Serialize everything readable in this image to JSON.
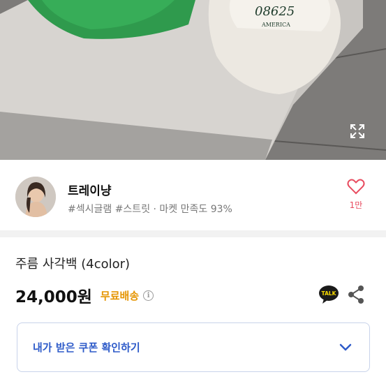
{
  "hero": {
    "cap_text_top": "08625",
    "cap_text_bottom": "AMERICA"
  },
  "seller": {
    "name": "트레이냥",
    "tags": "#섹시글램 #스트릿 · 마켓 만족도 93%",
    "like_count": "1만"
  },
  "product": {
    "name": "주름 사각백 (4color)",
    "price": "24,000원",
    "shipping": "무료배송",
    "info_glyph": "i",
    "talk_badge": "TALK"
  },
  "coupon": {
    "label": "내가 받은 쿠폰 확인하기"
  },
  "colors": {
    "accent_blue": "#2e5bc9",
    "shipping_orange": "#e59400",
    "like_pink": "#e84b5f"
  }
}
